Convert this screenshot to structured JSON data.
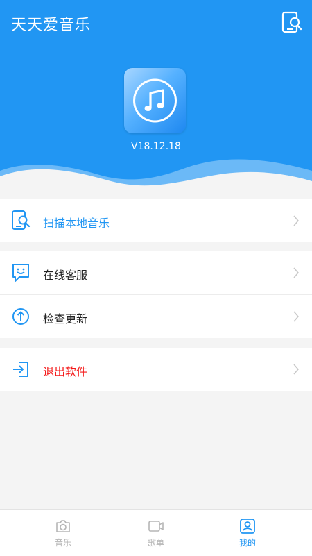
{
  "app_bar": {
    "title": "天天爱音乐"
  },
  "hero": {
    "version": "V18.12.18"
  },
  "menu": {
    "scan_local": "扫描本地音乐",
    "online_service": "在线客服",
    "check_update": "检查更新",
    "exit_app": "退出软件"
  },
  "tabs": [
    {
      "label": "音乐",
      "icon": "camera-icon",
      "active": false
    },
    {
      "label": "歌单",
      "icon": "video-icon",
      "active": false
    },
    {
      "label": "我的",
      "icon": "profile-icon",
      "active": true
    }
  ],
  "colors": {
    "primary": "#2196f3",
    "danger": "#f41a1a",
    "background": "#f4f4f4",
    "inactive": "#b5b5b5"
  },
  "icons": {
    "app_bar": "scan-search-icon",
    "app_logo": "music-note-icon",
    "scan_local": "phone-search-icon",
    "online_service": "chat-smile-icon",
    "check_update": "upload-arrow-icon",
    "exit_app": "exit-arrow-icon",
    "row_action": "chevron-right-icon"
  }
}
